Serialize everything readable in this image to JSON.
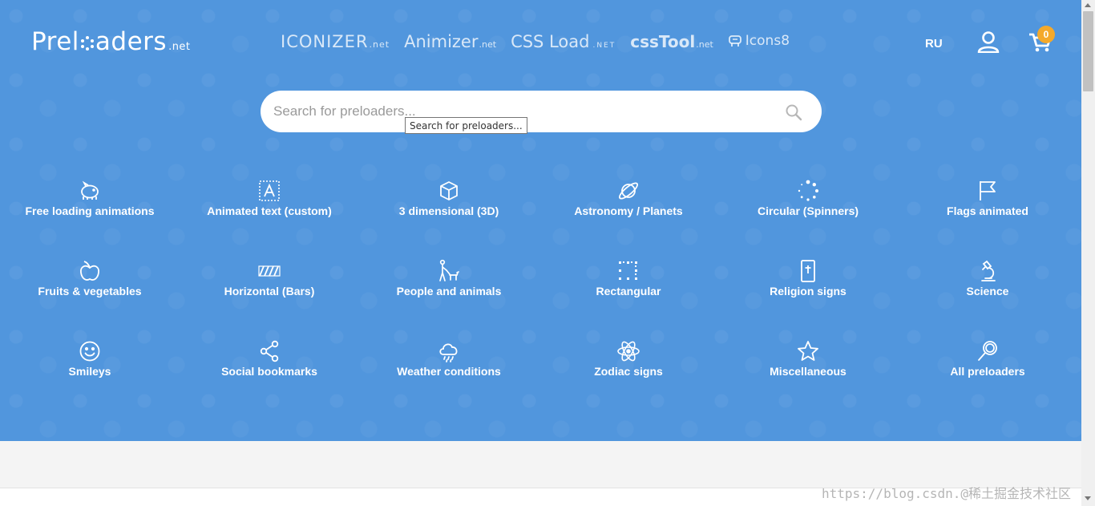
{
  "header": {
    "logo": {
      "pre": "Prel",
      "post": "aders",
      "suffix": ".net"
    },
    "partners": [
      {
        "main": "ICONIZER",
        "suffix": ".net"
      },
      {
        "main": "Animizer",
        "suffix": ".net"
      },
      {
        "main": "CSS Load",
        "suffix": ".NET"
      },
      {
        "main": "cssTool",
        "suffix": ".net"
      },
      {
        "main": "Icons8",
        "suffix": ""
      }
    ],
    "lang": "RU",
    "cart_count": "0"
  },
  "search": {
    "placeholder": "Search for preloaders...",
    "tooltip": "Search for preloaders..."
  },
  "categories": [
    {
      "label": "Free loading animations",
      "icon": "piggy-bank-icon"
    },
    {
      "label": "Animated text (custom)",
      "icon": "text-frame-icon"
    },
    {
      "label": "3 dimensional (3D)",
      "icon": "cube-icon"
    },
    {
      "label": "Astronomy / Planets",
      "icon": "planet-icon"
    },
    {
      "label": "Circular (Spinners)",
      "icon": "spinner-icon"
    },
    {
      "label": "Flags animated",
      "icon": "flag-icon"
    },
    {
      "label": "Fruits & vegetables",
      "icon": "apple-icon"
    },
    {
      "label": "Horizontal (Bars)",
      "icon": "bars-icon"
    },
    {
      "label": "People and animals",
      "icon": "person-dog-icon"
    },
    {
      "label": "Rectangular",
      "icon": "dotted-square-icon"
    },
    {
      "label": "Religion signs",
      "icon": "bible-icon"
    },
    {
      "label": "Science",
      "icon": "microscope-icon"
    },
    {
      "label": "Smileys",
      "icon": "smiley-icon"
    },
    {
      "label": "Social bookmarks",
      "icon": "share-icon"
    },
    {
      "label": "Weather conditions",
      "icon": "cloud-rain-icon"
    },
    {
      "label": "Zodiac signs",
      "icon": "atom-icon"
    },
    {
      "label": "Miscellaneous",
      "icon": "star-icon"
    },
    {
      "label": "All preloaders",
      "icon": "magnifier-icon"
    }
  ],
  "watermark": "https://blog.csdn.@稀土掘金技术社区",
  "colors": {
    "hero_bg": "#5196dd",
    "badge": "#f4a92b"
  }
}
